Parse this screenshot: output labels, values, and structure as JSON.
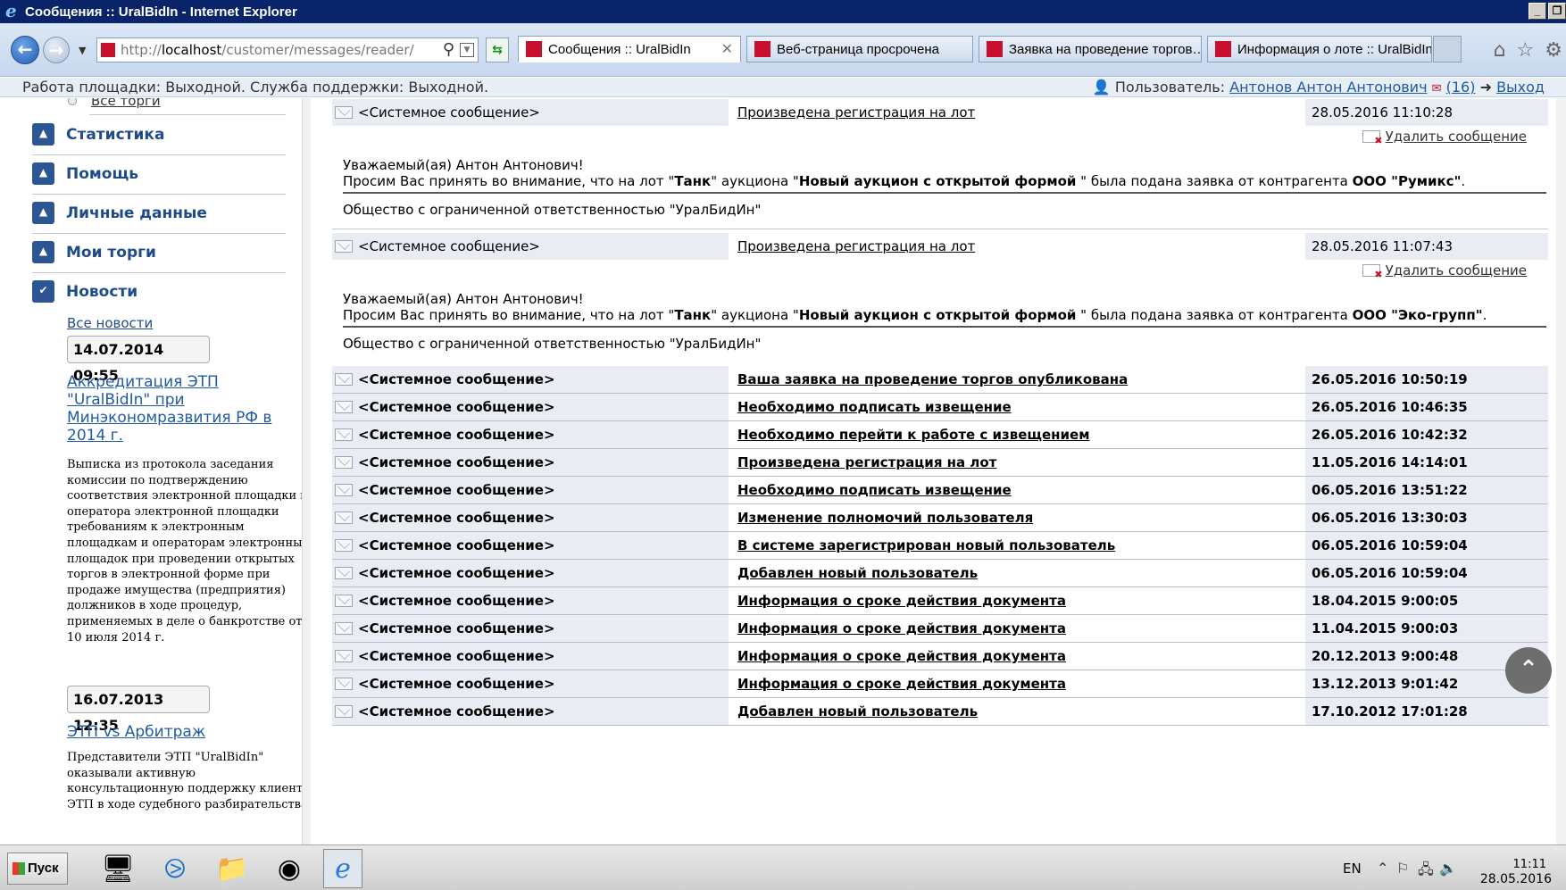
{
  "window": {
    "title": "Сообщения :: UralBidIn - Internet Explorer",
    "buttons": [
      "_",
      "❐"
    ]
  },
  "browser": {
    "address_prefix": "http://",
    "address_host": "localhost",
    "address_path": "/customer/messages/reader/",
    "tabs": [
      {
        "label": "Сообщения :: UralBidIn",
        "active": true
      },
      {
        "label": "Веб-страница просрочена",
        "active": false
      },
      {
        "label": "Заявка на проведение торгов…",
        "active": false
      },
      {
        "label": "Информация о лоте :: UralBidIn",
        "active": false
      }
    ]
  },
  "status": {
    "left": "Работа площадки: Выходной. Служба поддержки: Выходной.",
    "user_label": "Пользователь:",
    "user_name": "Антонов Антон Антонович",
    "mail_count": "(16)",
    "logout": "Выход"
  },
  "sidebar": {
    "radio_label": "Все торги",
    "sections": [
      {
        "label": "Статистика",
        "icon": "chevron-up-icon",
        "symbol": "▲"
      },
      {
        "label": "Помощь",
        "icon": "chevron-up-icon",
        "symbol": "▲"
      },
      {
        "label": "Личные данные",
        "icon": "chevron-up-icon",
        "symbol": "▲"
      },
      {
        "label": "Мои торги",
        "icon": "chevron-up-icon",
        "symbol": "▲"
      },
      {
        "label": "Новости",
        "icon": "check-icon",
        "symbol": "✔"
      }
    ],
    "all_news": "Все новости",
    "news": [
      {
        "date": "14.07.2014 09:55",
        "title": "Аккредитация ЭТП \"UralBidIn\" при Минэкономразвития РФ в 2014 г.",
        "body": "Выписка из протокола заседания комиссии по подтверждению соответствия электронной площадки и оператора электронной площадки требованиям к электронным площадкам и операторам электронных площадок при проведении открытых торгов в электронной форме при продаже имущества (предприятия) должников в ходе процедур, применяемых в деле о банкротстве от 10 июля 2014 г."
      },
      {
        "date": "16.07.2013 12:35",
        "title": "ЭТП vs Арбитраж",
        "body": "Представители ЭТП \"UralBidIn\" оказывали активную консультационную поддержку клиента ЭТП в ходе судебного разбирательства."
      }
    ]
  },
  "messages": {
    "delete_label": "Удалить сообщение",
    "greeting": "Уважаемый(ая) Антон Антонович!",
    "signature": "Общество с ограниченной ответственностью \"УралБидИн\"",
    "expanded": [
      {
        "from": "<Системное сообщение>",
        "subject": "Произведена регистрация на лот",
        "date": "28.05.2016 11:10:28",
        "text_a": "Просим Вас принять во внимание, что на лот \"",
        "lot": "Танк",
        "text_b": "\" аукциона \"",
        "auction": "Новый аукцион с открытой формой",
        "text_c": " \" была подана заявка от контрагента ",
        "company": "ООО \"Румикс\"",
        "text_d": "."
      },
      {
        "from": "<Системное сообщение>",
        "subject": "Произведена регистрация на лот",
        "date": "28.05.2016 11:07:43",
        "text_a": "Просим Вас принять во внимание, что на лот \"",
        "lot": "Танк",
        "text_b": "\" аукциона \"",
        "auction": "Новый аукцион с открытой формой",
        "text_c": " \" была подана заявка от контрагента ",
        "company": "ООО \"Эко-групп\"",
        "text_d": "."
      }
    ],
    "list": [
      {
        "from": "<Системное сообщение>",
        "subject": "Ваша заявка на проведение торгов опубликована",
        "date": "26.05.2016 10:50:19"
      },
      {
        "from": "<Системное сообщение>",
        "subject": "Необходимо подписать извещение",
        "date": "26.05.2016 10:46:35"
      },
      {
        "from": "<Системное сообщение>",
        "subject": "Необходимо перейти к работе с извещением",
        "date": "26.05.2016 10:42:32"
      },
      {
        "from": "<Системное сообщение>",
        "subject": "Произведена регистрация на лот",
        "date": "11.05.2016 14:14:01"
      },
      {
        "from": "<Системное сообщение>",
        "subject": "Необходимо подписать извещение",
        "date": "06.05.2016 13:51:22"
      },
      {
        "from": "<Системное сообщение>",
        "subject": "Изменение полномочий пользователя",
        "date": "06.05.2016 13:30:03"
      },
      {
        "from": "<Системное сообщение>",
        "subject": "В системе зарегистрирован новый пользователь",
        "date": "06.05.2016 10:59:04"
      },
      {
        "from": "<Системное сообщение>",
        "subject": "Добавлен новый пользователь",
        "date": "06.05.2016 10:59:04"
      },
      {
        "from": "<Системное сообщение>",
        "subject": "Информация о сроке действия документа",
        "date": "18.04.2015 9:00:05"
      },
      {
        "from": "<Системное сообщение>",
        "subject": "Информация о сроке действия документа",
        "date": "11.04.2015 9:00:03"
      },
      {
        "from": "<Системное сообщение>",
        "subject": "Информация о сроке действия документа",
        "date": "20.12.2013 9:00:48"
      },
      {
        "from": "<Системное сообщение>",
        "subject": "Информация о сроке действия документа",
        "date": "13.12.2013 9:01:42"
      },
      {
        "from": "<Системное сообщение>",
        "subject": "Добавлен новый пользователь",
        "date": "17.10.2012 17:01:28"
      }
    ]
  },
  "taskbar": {
    "start_label": "Пуск",
    "lang": "EN",
    "time": "11:11",
    "date": "28.05.2016"
  },
  "colors": {
    "titlebar": "#0a246a",
    "sidebar_accent": "#2c5594",
    "link": "#1f5ba4",
    "row_shade": "#e9edf3"
  }
}
